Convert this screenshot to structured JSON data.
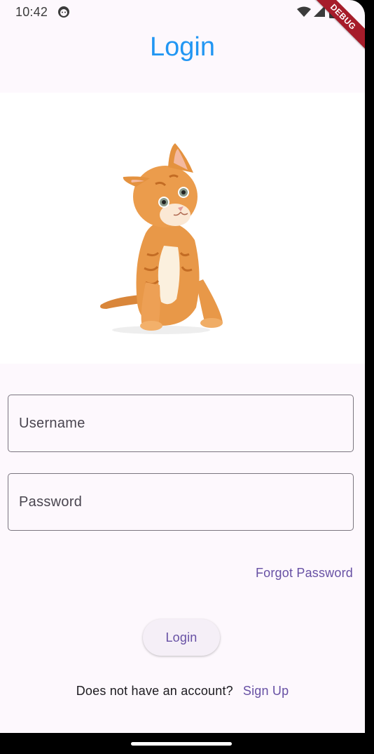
{
  "status_bar": {
    "time": "10:42",
    "icons": [
      "notification-icon",
      "wifi-icon",
      "signal-icon",
      "battery-icon"
    ]
  },
  "debug_banner": "DEBUG",
  "app_bar": {
    "title": "Login",
    "title_color": "#2196f3"
  },
  "hero_image": {
    "description_icon": "kitten-image"
  },
  "form": {
    "username_placeholder": "Username",
    "password_placeholder": "Password",
    "forgot_password": "Forgot Password",
    "login_button": "Login"
  },
  "signup": {
    "prompt": "Does not have an account?",
    "link": "Sign Up"
  },
  "colors": {
    "accent": "#6750a4",
    "background": "#fdf8fd",
    "outline": "#7a757f"
  }
}
